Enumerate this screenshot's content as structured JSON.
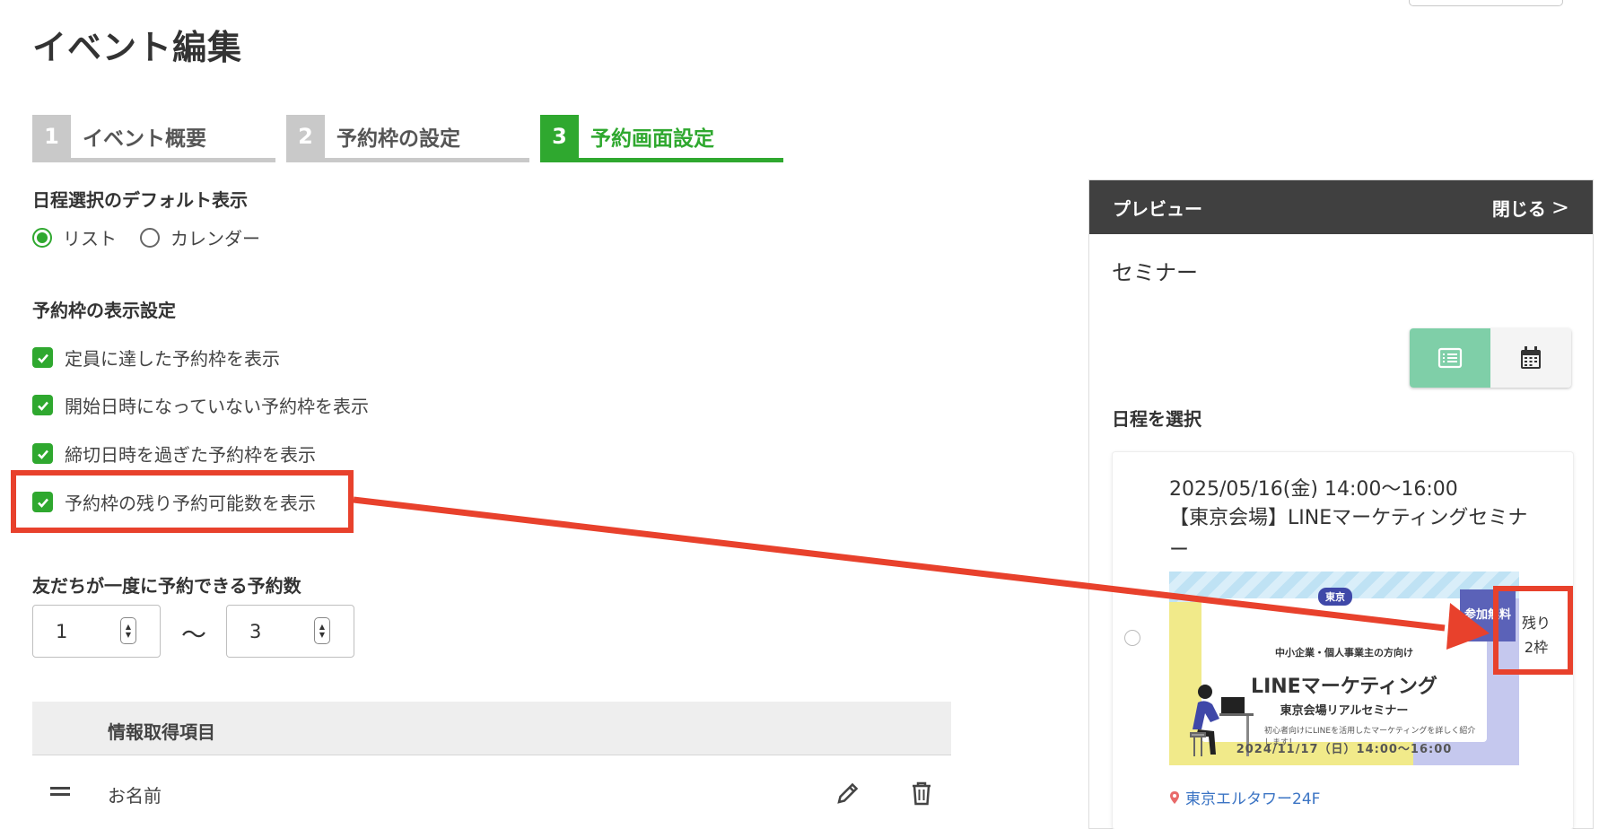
{
  "page_title": "イベント編集",
  "steps": [
    {
      "num": "1",
      "label": "イベント概要",
      "active": false
    },
    {
      "num": "2",
      "label": "予約枠の設定",
      "active": false
    },
    {
      "num": "3",
      "label": "予約画面設定",
      "active": true
    }
  ],
  "schedule_default": {
    "label": "日程選択のデフォルト表示",
    "options": [
      "リスト",
      "カレンダー"
    ],
    "selected": "リスト"
  },
  "slot_display": {
    "label": "予約枠の表示設定",
    "checks": [
      "定員に達した予約枠を表示",
      "開始日時になっていない予約枠を表示",
      "締切日時を過ぎた予約枠を表示",
      "予約枠の残り予約可能数を表示"
    ]
  },
  "booking_count": {
    "label": "友だちが一度に予約できる予約数",
    "min": "1",
    "separator": "〜",
    "max": "3"
  },
  "info_table": {
    "header": "情報取得項目",
    "rows": [
      "お名前"
    ]
  },
  "preview": {
    "header_title": "プレビュー",
    "close_label": "閉じる",
    "event_name": "セミナー",
    "select_label": "日程を選択",
    "slot": {
      "date": "2025/05/16(金) 14:00〜16:00",
      "title": "【東京会場】LINEマーケティングセミナー",
      "remain_line1": "残り",
      "remain_line2": "2枠",
      "venue": "東京エルタワー24F"
    },
    "banner": {
      "tag": "東京",
      "small": "中小企業・個人事業主の方向け",
      "big": "LINEマーケティング",
      "sub": "東京会場リアルセミナー",
      "desc": "初心者向けにLINEを活用したマーケティングを詳しく紹介します！",
      "date": "2024/11/17（日）14:00〜16:00",
      "free": "参加無料"
    }
  },
  "colors": {
    "accent_green": "#2fa82f",
    "highlight_red": "#e8412c",
    "preview_header": "#404040",
    "toggle_active": "#7fcfa8",
    "venue_link": "#3b74c4"
  }
}
